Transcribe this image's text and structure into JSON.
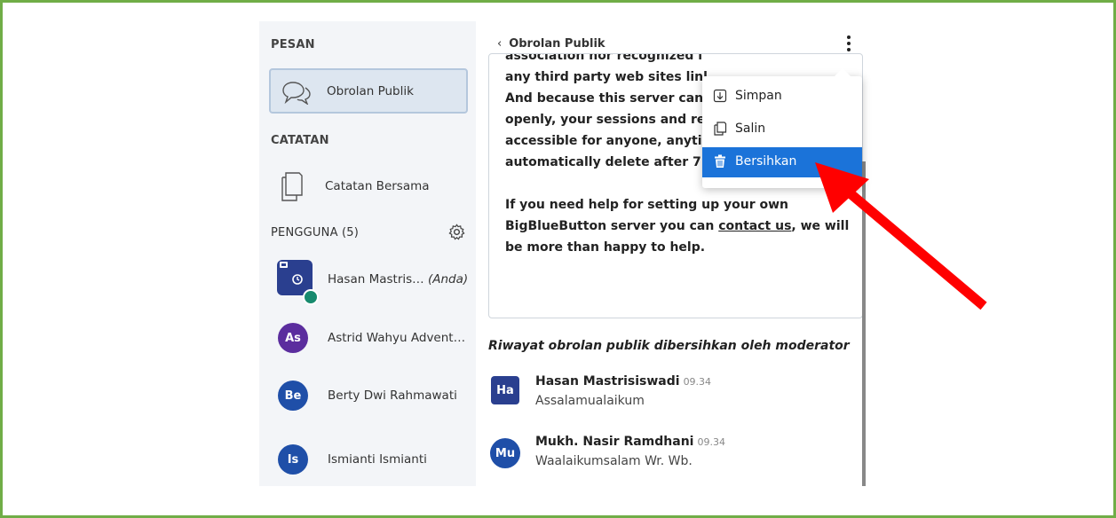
{
  "sidebar": {
    "messages_title": "PESAN",
    "public_chat_label": "Obrolan Publik",
    "notes_title": "CATATAN",
    "shared_notes_label": "Catatan Bersama",
    "users_title": "PENGGUNA (5)",
    "users": [
      {
        "initials": "",
        "name": "Hasan Mastris…",
        "suffix": "(Anda)",
        "color": "#2a3f8f"
      },
      {
        "initials": "As",
        "name": "Astrid Wahyu Advent…",
        "suffix": "",
        "color": "#5b2d9e"
      },
      {
        "initials": "Be",
        "name": "Berty Dwi Rahmawati",
        "suffix": "",
        "color": "#1f4fa8"
      },
      {
        "initials": "Is",
        "name": "Ismianti Ismianti",
        "suffix": "",
        "color": "#1f4fa8"
      }
    ]
  },
  "main": {
    "back_chevron": "‹",
    "title": "Obrolan Publik",
    "welcome_lines": [
      "association nor recognized l",
      "any third party web sites linl",
      "And because this server can",
      "openly, your sessions and re",
      "accessible for anyone, anytir",
      "automatically delete after 7 days."
    ],
    "help_pre": "If you need help for setting up your own BigBlueButton server you can ",
    "help_link": "contact us",
    "help_post": ", we will be more than happy to help.",
    "cleared_notice": "Riwayat obrolan publik dibersihkan oleh moderator",
    "messages": [
      {
        "initials": "Ha",
        "name": "Hasan Mastrisiswadi",
        "time": "09.34",
        "body": "Assalamualaikum",
        "color": "#2a3f8f",
        "shape": "square"
      },
      {
        "initials": "Mu",
        "name": "Mukh. Nasir Ramdhani",
        "time": "09.34",
        "body": "Waalaikumsalam Wr. Wb.",
        "color": "#1f4fa8",
        "shape": "circle"
      }
    ]
  },
  "menu": {
    "items": [
      {
        "label": "Simpan",
        "icon": "download-icon"
      },
      {
        "label": "Salin",
        "icon": "copy-icon"
      },
      {
        "label": "Bersihkan",
        "icon": "trash-icon",
        "active": true
      }
    ]
  },
  "colors": {
    "frame_border": "#70ad47",
    "accent": "#1b73d9",
    "annotation_arrow": "#ff0000"
  }
}
